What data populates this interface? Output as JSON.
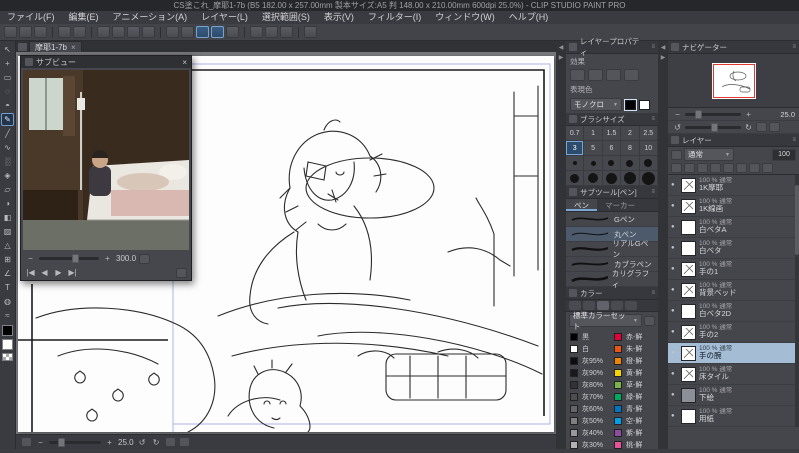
{
  "glyphs": {
    "close": "×",
    "dropdown": "▼",
    "minus": "−",
    "plus": "+",
    "prev": "◀",
    "next": "▶",
    "first": "|◀",
    "last": "▶|",
    "undo": "↺",
    "redo": "↻",
    "eye": "●",
    "collapse_left": "◀",
    "collapse_right": "▶",
    "menu_dots": "≡"
  },
  "window": {
    "title": "CS塗これ_摩耶1-7b (B5 182.00 x 257.00mm 製本サイズ:A5 判 148.00 x 210.00mm 600dpi 25.0%) - CLIP STUDIO PAINT PRO"
  },
  "menu": {
    "items": [
      "ファイル(F)",
      "編集(E)",
      "アニメーション(A)",
      "レイヤー(L)",
      "選択範囲(S)",
      "表示(V)",
      "フィルター(I)",
      "ウィンドウ(W)",
      "ヘルプ(H)"
    ]
  },
  "doc_tab": {
    "label": "摩耶1-7b"
  },
  "left_tools": {
    "items": [
      {
        "name": "operation-tool",
        "glyph": "↖"
      },
      {
        "name": "move-tool",
        "glyph": "+"
      },
      {
        "name": "selection-tool",
        "glyph": "▭"
      },
      {
        "name": "auto-select-tool",
        "glyph": "◌"
      },
      {
        "name": "eyedropper-tool",
        "glyph": "◓"
      },
      {
        "name": "pen-tool",
        "glyph": "✎"
      },
      {
        "name": "pencil-tool",
        "glyph": "╱"
      },
      {
        "name": "brush-tool",
        "glyph": "∿"
      },
      {
        "name": "airbrush-tool",
        "glyph": "░"
      },
      {
        "name": "decoration-tool",
        "glyph": "◈"
      },
      {
        "name": "eraser-tool",
        "glyph": "▱"
      },
      {
        "name": "blend-tool",
        "glyph": "◑"
      },
      {
        "name": "fill-tool",
        "glyph": "◧"
      },
      {
        "name": "gradient-tool",
        "glyph": "▨"
      },
      {
        "name": "figure-tool",
        "glyph": "△"
      },
      {
        "name": "frame-border-tool",
        "glyph": "⊞"
      },
      {
        "name": "ruler-tool",
        "glyph": "∠"
      },
      {
        "name": "text-tool",
        "glyph": "T"
      },
      {
        "name": "balloon-tool",
        "glyph": "◍"
      },
      {
        "name": "line-correct-tool",
        "glyph": "≈"
      }
    ]
  },
  "subview": {
    "title": "サブビュー",
    "zoom_value": "300.0"
  },
  "canvas_bar": {
    "zoom_value": "25.0"
  },
  "layer_property": {
    "title": "レイヤープロパティ",
    "effect_label": "効果",
    "expression_label": "表現色",
    "expression_value": "モノクロ"
  },
  "brush_size": {
    "title": "ブラシサイズ",
    "row1": [
      "0.7",
      "1",
      "1.5",
      "2",
      "2.5"
    ],
    "row2": [
      "3",
      "5",
      "6",
      "8",
      "10"
    ]
  },
  "sub_tool": {
    "title": "サブツール[ペン]",
    "tabs": [
      "ペン",
      "マーカー"
    ],
    "items": [
      "Gペン",
      "丸ペン",
      "リアルGペン",
      "カブラペン",
      "カリグラフィ"
    ]
  },
  "color_panel": {
    "title": "カラー",
    "set_name": "標準カラーセット",
    "left": [
      {
        "name": "黒",
        "hex": "#000000"
      },
      {
        "name": "白",
        "hex": "#ffffff"
      },
      {
        "name": "灰95%",
        "hex": "#0d0d0d"
      },
      {
        "name": "灰90%",
        "hex": "#1a1a1a"
      },
      {
        "name": "灰80%",
        "hex": "#333333"
      },
      {
        "name": "灰70%",
        "hex": "#4d4d4d"
      },
      {
        "name": "灰60%",
        "hex": "#666666"
      },
      {
        "name": "灰50%",
        "hex": "#808080"
      },
      {
        "name": "灰40%",
        "hex": "#999999"
      },
      {
        "name": "灰30%",
        "hex": "#b3b3b3"
      }
    ],
    "right": [
      {
        "name": "赤-鮮",
        "hex": "#e60033"
      },
      {
        "name": "朱-鮮",
        "hex": "#ea5514"
      },
      {
        "name": "橙-鮮",
        "hex": "#f08300"
      },
      {
        "name": "黄-鮮",
        "hex": "#f6d500"
      },
      {
        "name": "草-鮮",
        "hex": "#7ab547"
      },
      {
        "name": "緑-鮮",
        "hex": "#00a960"
      },
      {
        "name": "青-鮮",
        "hex": "#0075c2"
      },
      {
        "name": "空-鮮",
        "hex": "#00a0e9"
      },
      {
        "name": "紫-鮮",
        "hex": "#8f4b9e"
      },
      {
        "name": "桃-鮮",
        "hex": "#e85298"
      }
    ]
  },
  "navigator": {
    "title": "ナビゲーター",
    "zoom_value": "25.0"
  },
  "layers_panel": {
    "title": "レイヤー",
    "blend_mode": "通常",
    "opacity": "100",
    "items": [
      {
        "info": "100 % 通常",
        "name": "1K摩耶"
      },
      {
        "info": "100 % 通常",
        "name": "1K線画"
      },
      {
        "info": "100 % 通常",
        "name": "白ベタA"
      },
      {
        "info": "100 % 通常",
        "name": "白ベタ"
      },
      {
        "info": "100 % 通常",
        "name": "手の1"
      },
      {
        "info": "100 % 通常",
        "name": "背景ベッド"
      },
      {
        "info": "100 % 通常",
        "name": "白ベタ2D"
      },
      {
        "info": "100 % 通常",
        "name": "手の2"
      },
      {
        "info": "100 % 通常",
        "name": "手の腕",
        "selected": true
      },
      {
        "info": "100 % 通常",
        "name": "床タイル"
      },
      {
        "info": "100 % 通常",
        "name": "下絵"
      },
      {
        "info": "100 % 通常",
        "name": "用紙"
      }
    ]
  }
}
